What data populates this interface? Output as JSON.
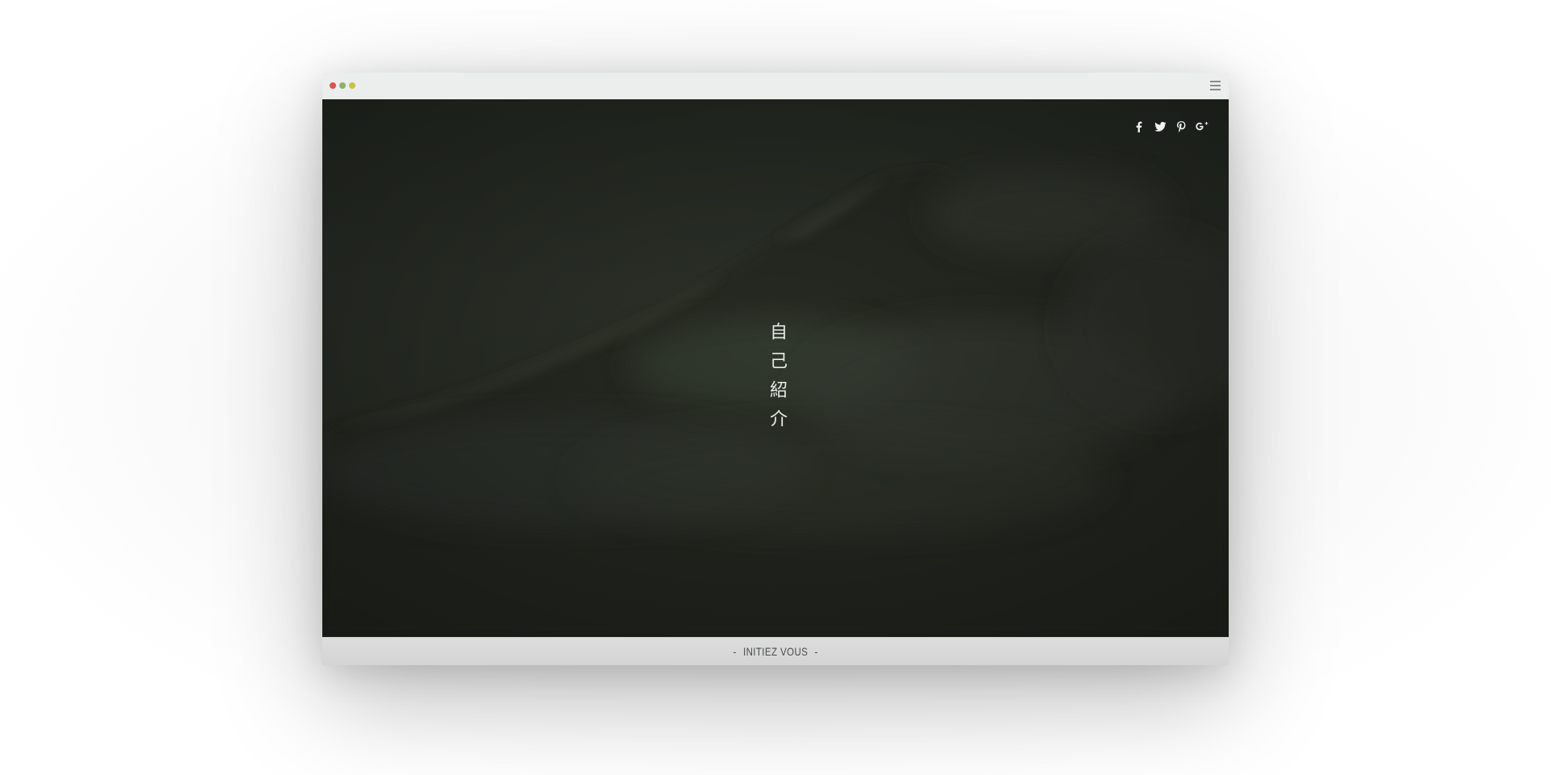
{
  "window": {
    "controls": [
      "close",
      "minimize",
      "maximize"
    ],
    "menu_icon": "hamburger-menu-icon"
  },
  "hero": {
    "title": "自己紹介",
    "social": [
      {
        "name": "facebook",
        "icon": "facebook-icon"
      },
      {
        "name": "twitter",
        "icon": "twitter-icon"
      },
      {
        "name": "pinterest",
        "icon": "pinterest-icon"
      },
      {
        "name": "google-plus",
        "icon": "google-plus-icon"
      }
    ]
  },
  "footer": {
    "dash_left": "-",
    "label": "INITIEZ VOUS",
    "dash_right": "-"
  },
  "colors": {
    "hero_bg": "#2a3027",
    "footer_bg": "#d6d7d6",
    "dot_red": "#d9534f",
    "dot_green": "#8db36a",
    "dot_yellow": "#c9c24a"
  }
}
